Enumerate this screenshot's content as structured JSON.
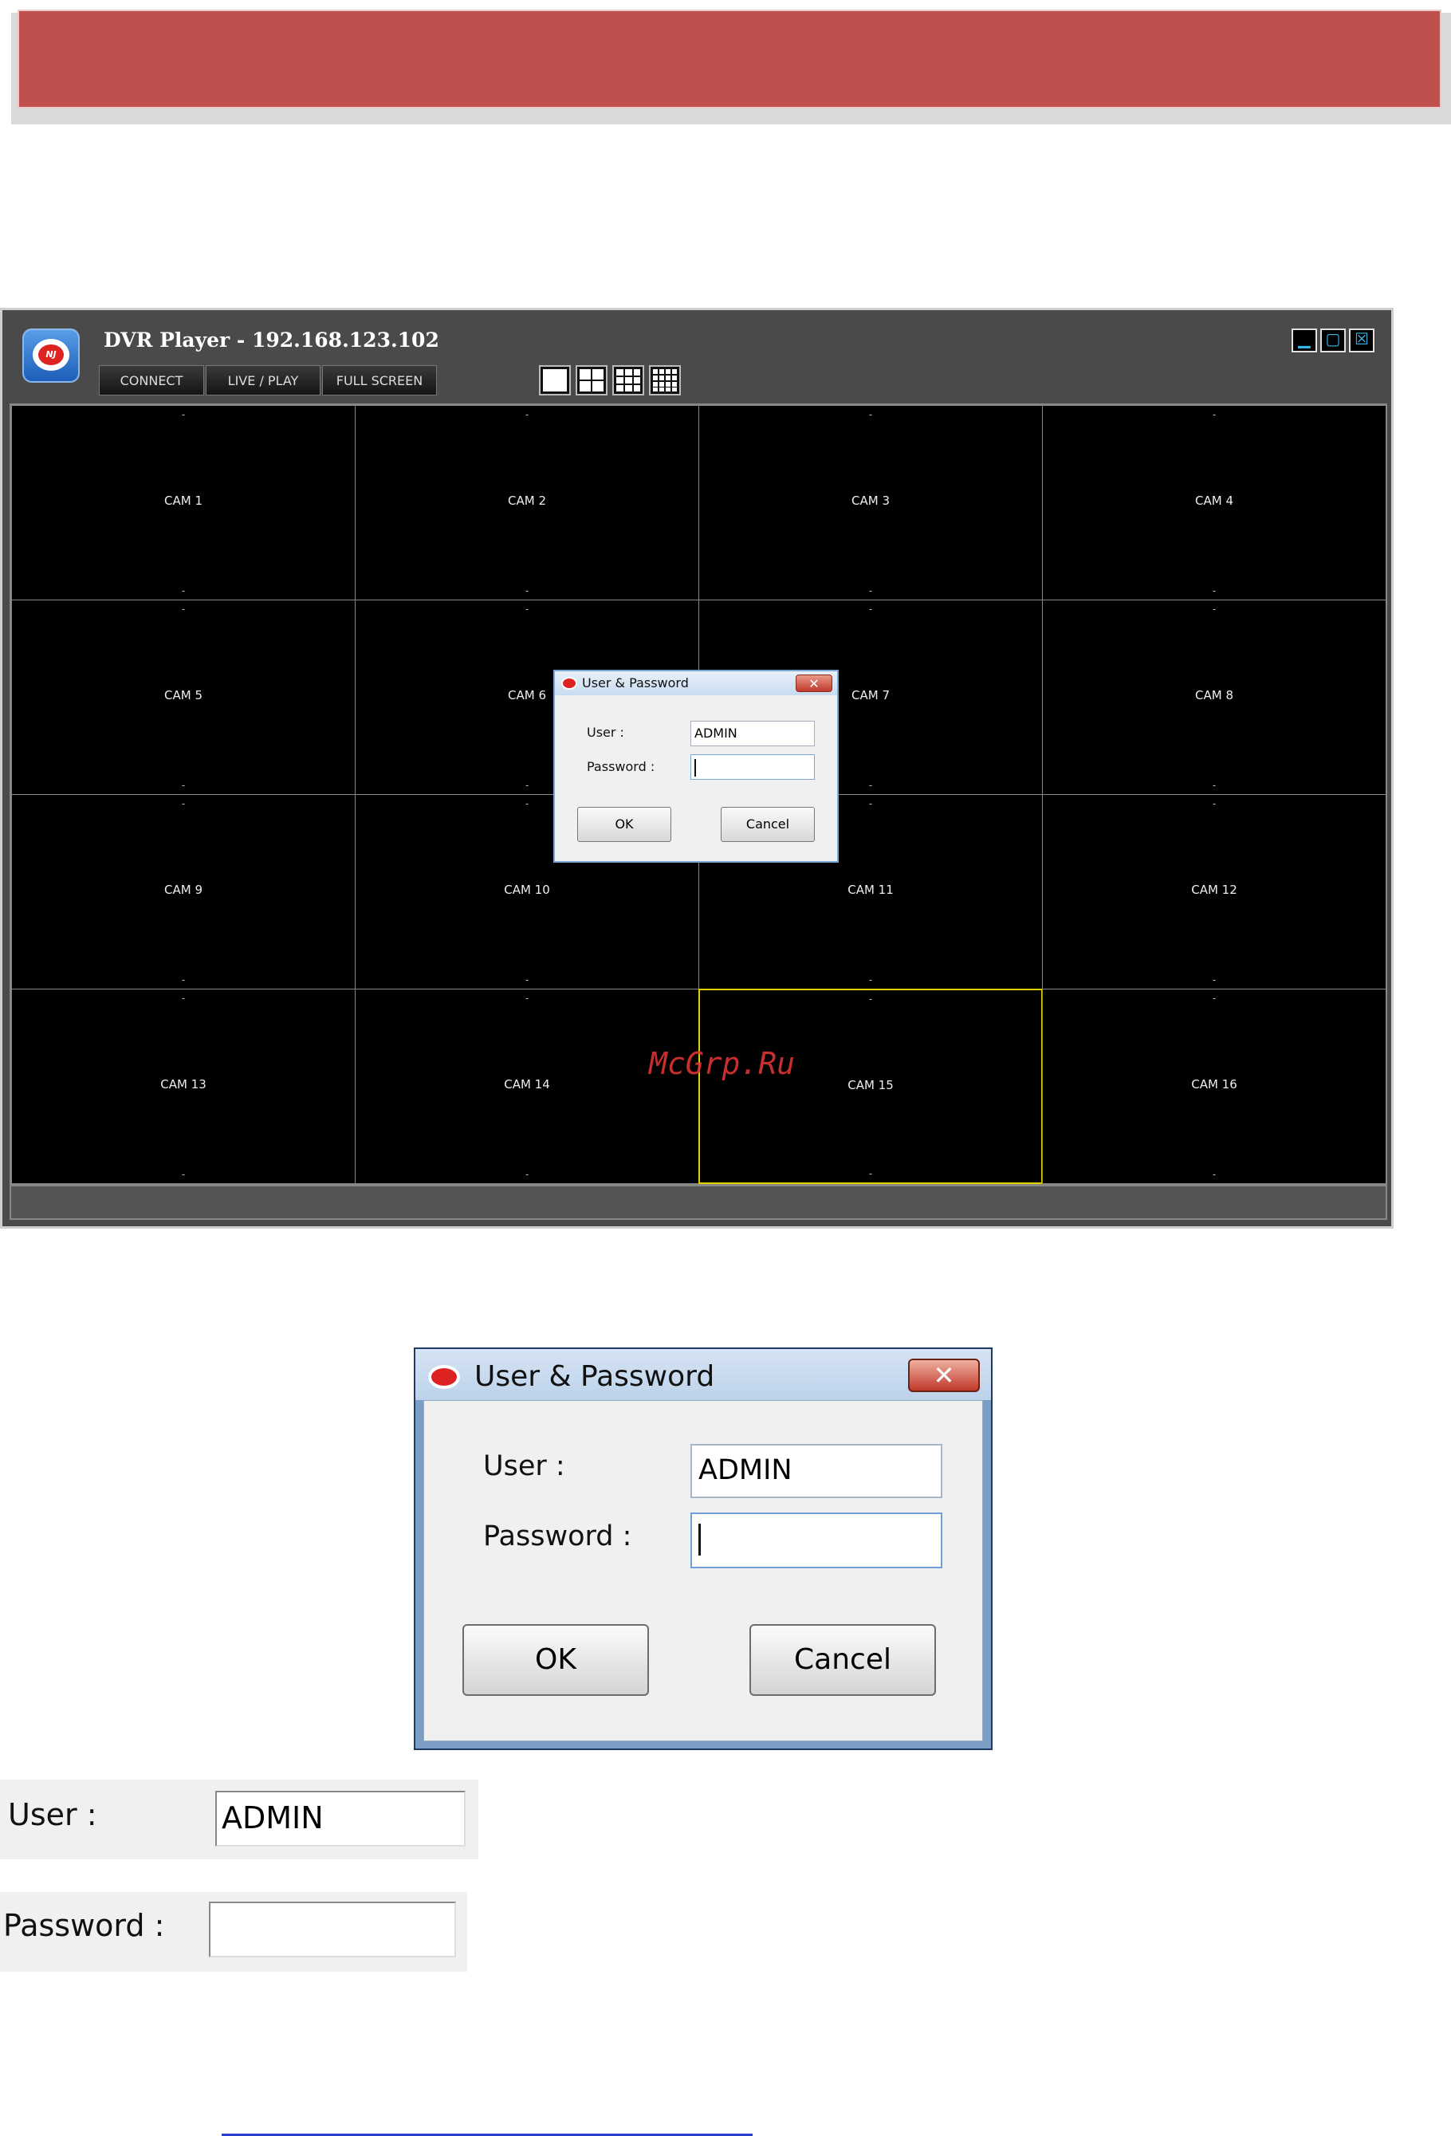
{
  "window": {
    "title": "DVR Player - 192.168.123.102",
    "menu": [
      "CONNECT",
      "LIVE / PLAY",
      "FULL SCREEN"
    ],
    "layout_buttons": [
      "layout-1-icon",
      "layout-4-icon",
      "layout-9-icon",
      "layout-16-icon"
    ],
    "window_controls": [
      "minimize-icon",
      "maximize-icon",
      "close-icon"
    ]
  },
  "cameras": [
    {
      "label": "CAM 1",
      "top": "-",
      "bottom": "-"
    },
    {
      "label": "CAM 2",
      "top": "-",
      "bottom": "-"
    },
    {
      "label": "CAM 3",
      "top": "-",
      "bottom": "-"
    },
    {
      "label": "CAM 4",
      "top": "-",
      "bottom": "-"
    },
    {
      "label": "CAM 5",
      "top": "-",
      "bottom": "-"
    },
    {
      "label": "CAM 6",
      "top": "-",
      "bottom": "-"
    },
    {
      "label": "CAM 7",
      "top": "-",
      "bottom": "-"
    },
    {
      "label": "CAM 8",
      "top": "-",
      "bottom": "-"
    },
    {
      "label": "CAM 9",
      "top": "-",
      "bottom": "-"
    },
    {
      "label": "CAM 10",
      "top": "-",
      "bottom": "-"
    },
    {
      "label": "CAM 11",
      "top": "-",
      "bottom": "-"
    },
    {
      "label": "CAM 12",
      "top": "-",
      "bottom": "-"
    },
    {
      "label": "CAM 13",
      "top": "-",
      "bottom": "-"
    },
    {
      "label": "CAM 14",
      "top": "-",
      "bottom": "-"
    },
    {
      "label": "CAM 15",
      "top": "-",
      "bottom": "-",
      "selected": true
    },
    {
      "label": "CAM 16",
      "top": "-",
      "bottom": "-"
    }
  ],
  "watermark": "McGrp.Ru",
  "dialog": {
    "title": "User & Password",
    "user_label": "User :",
    "user_value": "ADMIN",
    "password_label": "Password :",
    "password_value": "",
    "ok_label": "OK",
    "cancel_label": "Cancel"
  },
  "zoom": {
    "user_label": "User :",
    "user_value": "ADMIN",
    "password_label": "Password :",
    "password_value": ""
  },
  "colors": {
    "banner": "#c0504d",
    "selected_cell": "#e0d000",
    "window_bg": "#4a4a4a"
  }
}
